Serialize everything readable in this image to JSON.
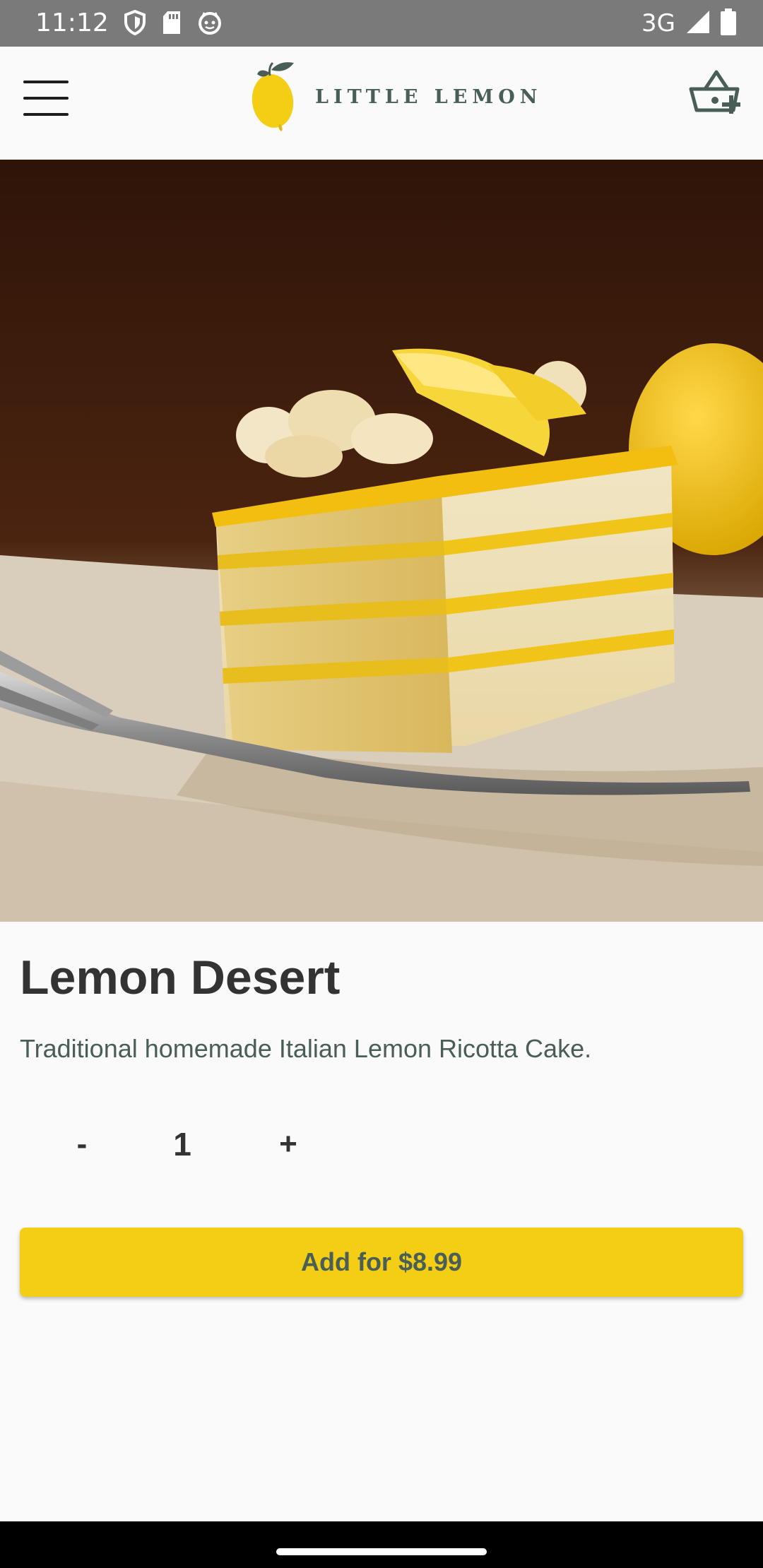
{
  "status_bar": {
    "time": "11:12",
    "network": "3G",
    "icons": [
      "shield-icon",
      "sd-card-icon",
      "cat-icon",
      "signal-icon",
      "battery-icon"
    ]
  },
  "app_bar": {
    "logo_text": "LITTLE LEMON",
    "menu_icon": "hamburger-menu-icon",
    "cart_icon": "basket-add-icon"
  },
  "hero": {
    "image": "lemon-cake-photo"
  },
  "product": {
    "title": "Lemon Desert",
    "description": "Traditional homemade Italian Lemon Ricotta Cake.",
    "decrement_label": "-",
    "quantity": "1",
    "increment_label": "+",
    "add_button_label": "Add for $8.99"
  },
  "colors": {
    "primary_yellow": "#F4CE14",
    "primary_green": "#495E57",
    "text_dark": "#333333",
    "background": "#FAFAFA"
  }
}
